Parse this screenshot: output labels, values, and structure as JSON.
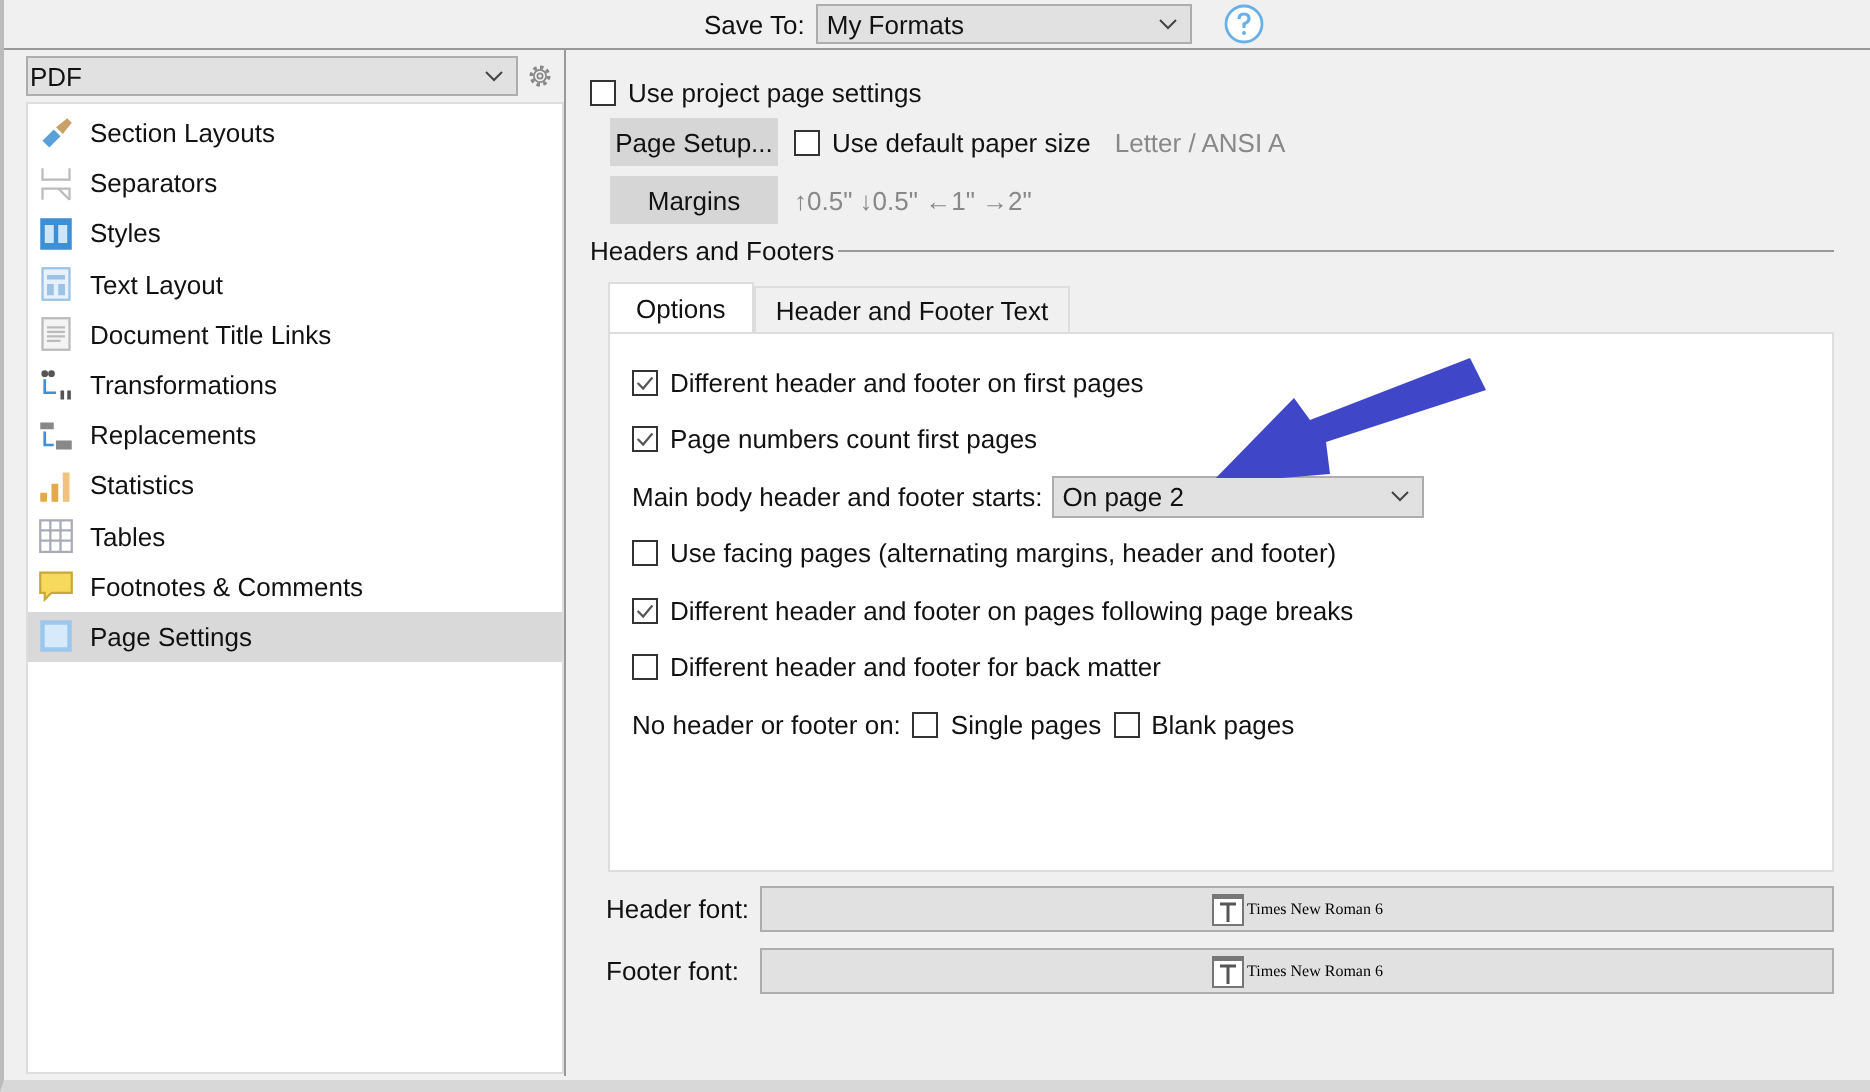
{
  "save_to": {
    "label": "Save To:",
    "value": "My Formats"
  },
  "format_select": {
    "value": "PDF"
  },
  "sidebar": {
    "items": [
      {
        "label": "Section Layouts",
        "kind": "brush",
        "selected": false
      },
      {
        "label": "Separators",
        "kind": "separator",
        "selected": false
      },
      {
        "label": "Styles",
        "kind": "styles",
        "selected": false
      },
      {
        "label": "Text Layout",
        "kind": "layout",
        "selected": false
      },
      {
        "label": "Document Title Links",
        "kind": "document",
        "selected": false
      },
      {
        "label": "Transformations",
        "kind": "transform",
        "selected": false
      },
      {
        "label": "Replacements",
        "kind": "replace",
        "selected": false
      },
      {
        "label": "Statistics",
        "kind": "stats",
        "selected": false
      },
      {
        "label": "Tables",
        "kind": "table",
        "selected": false
      },
      {
        "label": "Footnotes & Comments",
        "kind": "footnote",
        "selected": false
      },
      {
        "label": "Page Settings",
        "kind": "page",
        "selected": true
      }
    ]
  },
  "use_project_page_settings": {
    "label": "Use project page settings",
    "checked": false
  },
  "page_setup_button": "Page Setup...",
  "use_default_paper": {
    "label": "Use default paper size",
    "checked": false
  },
  "paper_size": "Letter / ANSI A",
  "margins_button": "Margins",
  "margins_summary": "↑0.5\" ↓0.5\" ←1\" →2\"",
  "headers_and_footers": {
    "title": "Headers and Footers",
    "tabs": [
      {
        "label": "Options",
        "selected": true
      },
      {
        "label": "Header and Footer Text",
        "selected": false
      }
    ],
    "options": [
      {
        "kind": "checkbox",
        "label": "Different header and footer on first pages",
        "checked": true
      },
      {
        "kind": "checkbox",
        "label": "Page numbers count first pages",
        "checked": true
      },
      {
        "kind": "select",
        "label": "Main body header and footer starts:",
        "value": "On page 2"
      },
      {
        "kind": "checkbox",
        "label": "Use facing pages (alternating margins, header and footer)",
        "checked": false
      },
      {
        "kind": "checkbox",
        "label": "Different header and footer on pages following page breaks",
        "checked": true
      },
      {
        "kind": "checkbox",
        "label": "Different header and footer for back matter",
        "checked": false
      },
      {
        "kind": "inline_checks",
        "label": "No header or footer on:",
        "checks": [
          {
            "label": "Single pages",
            "checked": false
          },
          {
            "label": "Blank pages",
            "checked": false
          }
        ]
      }
    ],
    "fonts": [
      {
        "label": "Header font:",
        "value": "Times New Roman 6"
      },
      {
        "label": "Footer font:",
        "value": "Times New Roman 6"
      }
    ]
  }
}
